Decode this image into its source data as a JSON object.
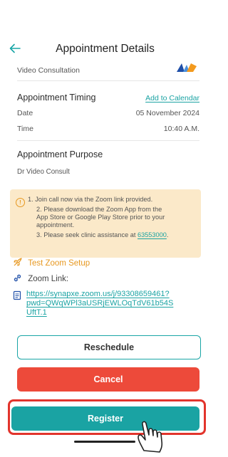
{
  "header": {
    "title": "Appointment Details"
  },
  "consultation": {
    "type": "Video Consultation"
  },
  "timing": {
    "title": "Appointment Timing",
    "add_to_calendar": "Add to Calendar",
    "date_label": "Date",
    "date_value": "05 November 2024",
    "time_label": "Time",
    "time_value": "10:40 A.M."
  },
  "purpose": {
    "title": "Appointment Purpose",
    "value": "Dr Video Consult"
  },
  "notice": {
    "line1": "1. Join call now via the Zoom link provided.",
    "line2a": "2. Please download the Zoom App from the",
    "line2b": "App Store or Google Play Store prior to your",
    "line2c": "appointment.",
    "line3_prefix": "3. Please seek clinic assistance at ",
    "line3_phone": "63553000",
    "line3_suffix": "."
  },
  "zoom": {
    "test_setup": "Test Zoom Setup",
    "link_label": "Zoom Link:",
    "link_line1": "https://synapxe.zoom.us/j/93308659461?",
    "link_line2": "pwd=QWqWPl3aUSRjEWLOqTdV61b54S",
    "link_line3": "UftT.1"
  },
  "buttons": {
    "reschedule": "Reschedule",
    "cancel": "Cancel",
    "register": "Register"
  },
  "colors": {
    "teal": "#1aa3a3",
    "red": "#ed4a3a",
    "highlight": "#e2342c",
    "notice_bg": "#fbe9c9",
    "notice_icon": "#e79820"
  }
}
